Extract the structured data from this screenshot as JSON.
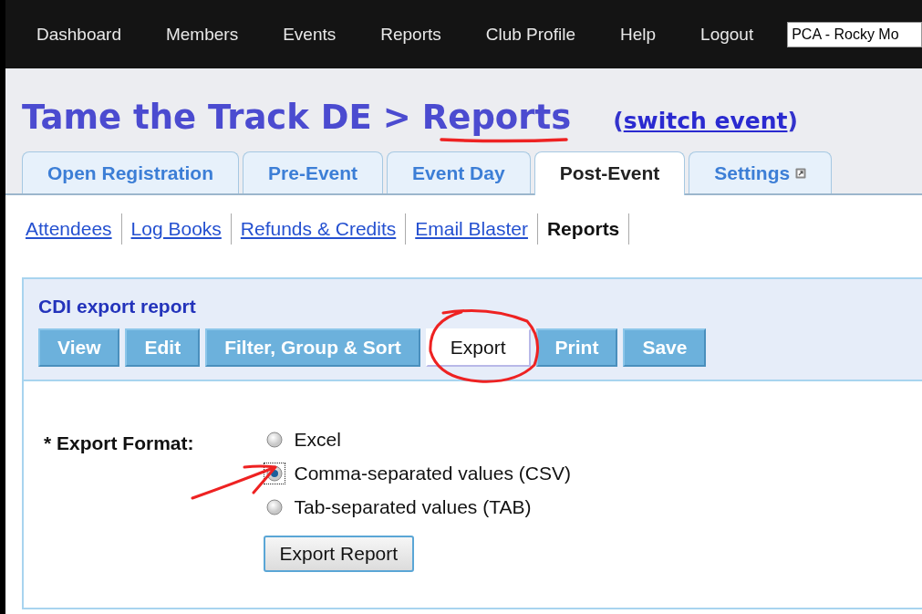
{
  "top_nav": {
    "items": [
      "Dashboard",
      "Members",
      "Events",
      "Reports",
      "Club Profile",
      "Help",
      "Logout"
    ],
    "club_select": {
      "value": "PCA - Rocky Mo"
    }
  },
  "header": {
    "event": "Tame the Track DE",
    "separator": ">",
    "section": "Reports",
    "switch_open": "(",
    "switch_link": "switch event",
    "switch_close": ")"
  },
  "tabs": [
    {
      "label": "Open Registration",
      "selected": false
    },
    {
      "label": "Pre-Event",
      "selected": false
    },
    {
      "label": "Event Day",
      "selected": false
    },
    {
      "label": "Post-Event",
      "selected": true
    },
    {
      "label": "Settings",
      "selected": false,
      "external": true
    }
  ],
  "sub_nav": [
    {
      "label": "Attendees",
      "selected": false
    },
    {
      "label": "Log Books",
      "selected": false
    },
    {
      "label": "Refunds & Credits",
      "selected": false
    },
    {
      "label": "Email Blaster",
      "selected": false
    },
    {
      "label": "Reports",
      "selected": true
    }
  ],
  "report": {
    "title": "CDI export report",
    "buttons": [
      {
        "label": "View",
        "selected": false
      },
      {
        "label": "Edit",
        "selected": false
      },
      {
        "label": "Filter, Group & Sort",
        "selected": false
      },
      {
        "label": "Export",
        "selected": true
      },
      {
        "label": "Print",
        "selected": false
      },
      {
        "label": "Save",
        "selected": false
      }
    ]
  },
  "export_form": {
    "label": "* Export Format:",
    "options": [
      {
        "label": "Excel",
        "selected": false
      },
      {
        "label": "Comma-separated values (CSV)",
        "selected": true
      },
      {
        "label": "Tab-separated values (TAB)",
        "selected": false
      }
    ],
    "submit": "Export Report"
  },
  "annotations": [
    {
      "kind": "underline"
    },
    {
      "kind": "circle"
    },
    {
      "kind": "arrow"
    }
  ]
}
